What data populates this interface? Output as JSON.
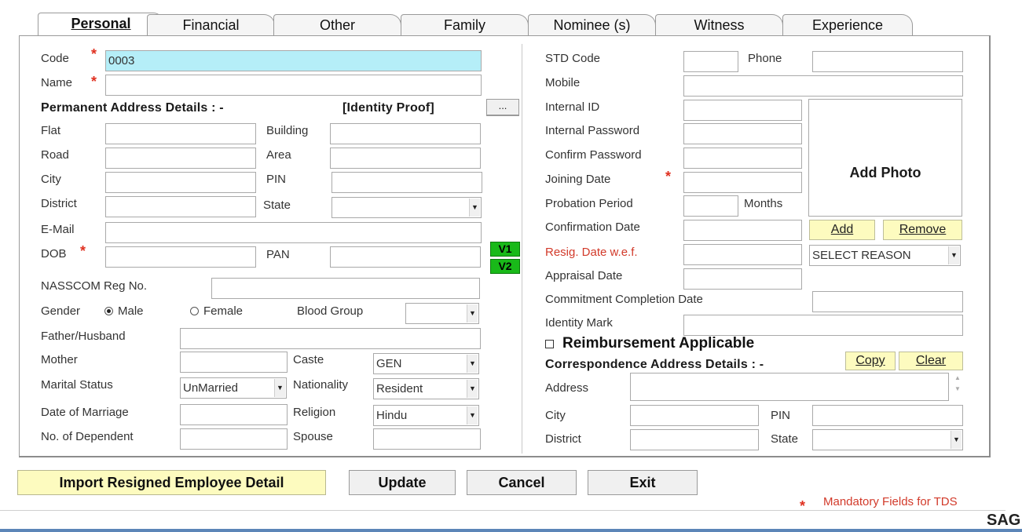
{
  "tabs": [
    "Personal",
    "Financial",
    "Other",
    "Family",
    "Nominee (s)",
    "Witness",
    "Experience"
  ],
  "tab_underline": [
    "P",
    "F",
    "O",
    "y",
    "N",
    "W",
    "x"
  ],
  "left": {
    "code_label": "Code",
    "code_value": "0003",
    "name_label": "Name",
    "perm_address_heading": "Permanent Address Details : -",
    "identity_proof": "[Identity Proof]",
    "identity_btn": "...",
    "flat": "Flat",
    "building": "Building",
    "road": "Road",
    "area": "Area",
    "city": "City",
    "pin": "PIN",
    "district": "District",
    "state": "State",
    "email": "E-Mail",
    "dob": "DOB",
    "pan": "PAN",
    "v1": "V1",
    "v2": "V2",
    "nasscom": "NASSCOM Reg No.",
    "gender": "Gender",
    "male": "Male",
    "female": "Female",
    "blood_group": "Blood Group",
    "father": "Father/Husband",
    "mother": "Mother",
    "caste": "Caste",
    "caste_value": "GEN",
    "marital": "Marital Status",
    "marital_value": "UnMarried",
    "nationality": "Nationality",
    "nationality_value": "Resident",
    "dom": "Date of Marriage",
    "religion": "Religion",
    "religion_value": "Hindu",
    "dependents": "No. of Dependent",
    "spouse": "Spouse"
  },
  "right": {
    "std_code": "STD Code",
    "phone": "Phone",
    "mobile": "Mobile",
    "internal_id": "Internal ID",
    "internal_password": "Internal Password",
    "confirm_password": "Confirm Password",
    "joining_date": "Joining Date",
    "probation": "Probation Period",
    "months": "Months",
    "confirmation_date": "Confirmation Date",
    "resig_date": "Resig. Date w.e.f.",
    "appraisal_date": "Appraisal Date",
    "commitment": "Commitment Completion Date",
    "identity_mark": "Identity Mark",
    "reimbursement": "Reimbursement Applicable",
    "corr_heading": "Correspondence Address Details : -",
    "copy": "Copy",
    "clear": "Clear",
    "address": "Address",
    "city": "City",
    "pin": "PIN",
    "district": "District",
    "state": "State",
    "add_photo": "Add Photo",
    "add": "Add",
    "remove": "Remove",
    "select_reason": "SELECT REASON"
  },
  "footer": {
    "import": "Import Resigned Employee Detail",
    "update": "Update",
    "cancel": "Cancel",
    "exit": "Exit",
    "mandatory_note": "Mandatory Fields for TDS",
    "watermark": "SAG"
  },
  "colors": {
    "mandatory_star": "#e03020",
    "code_field": "#b5eef8",
    "verify_button": "#19b919",
    "highlight_button": "#fdfbbf"
  }
}
